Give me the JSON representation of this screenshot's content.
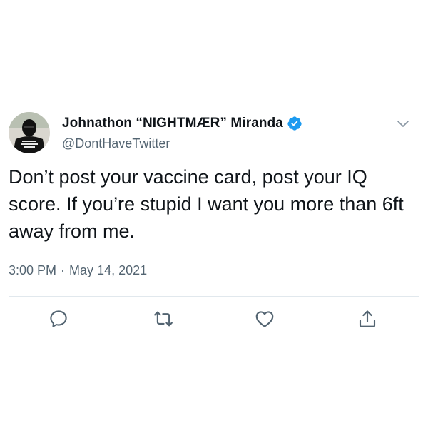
{
  "tweet": {
    "author": {
      "display_name": "Johnathon “NIGHTMÆR” Miranda",
      "handle": "@DontHaveTwitter",
      "verified": true
    },
    "text": "Don’t post your vaccine card, post your IQ score. If you’re stupid I want you more than 6ft away from me.",
    "time": "3:00 PM",
    "separator": "·",
    "date": "May 14, 2021",
    "actions": [
      "reply-icon",
      "retweet-icon",
      "like-icon",
      "share-icon"
    ]
  },
  "colors": {
    "text": "#0f1419",
    "secondary": "#536471",
    "verified_blue": "#1d9bf0",
    "divider": "#e1e8ed"
  }
}
